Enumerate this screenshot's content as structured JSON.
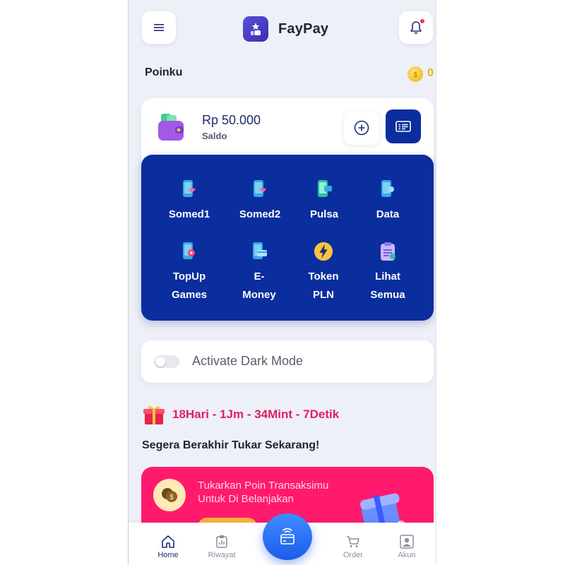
{
  "header": {
    "app_name": "FayPay"
  },
  "points": {
    "title": "Poinku",
    "value": "0"
  },
  "balance": {
    "amount": "Rp 50.000",
    "label": "Saldo"
  },
  "services": [
    {
      "label": "Somed1",
      "icon": "phone-heart-icon"
    },
    {
      "label": "Somed2",
      "icon": "phone-heart-icon"
    },
    {
      "label": "Pulsa",
      "icon": "phone-transfer-icon"
    },
    {
      "label": "Data",
      "icon": "phone-data-icon"
    },
    {
      "label_lines": [
        "TopUp",
        "Games"
      ],
      "icon": "phone-play-icon"
    },
    {
      "label_lines": [
        "E-",
        "Money"
      ],
      "icon": "emoney-card-icon"
    },
    {
      "label_lines": [
        "Token",
        "PLN"
      ],
      "icon": "lightning-icon"
    },
    {
      "label_lines": [
        "Lihat",
        "Semua"
      ],
      "icon": "clipboard-icon"
    }
  ],
  "dark_mode": {
    "label": "Activate Dark Mode",
    "enabled": false
  },
  "countdown": {
    "text": "18Hari - 1Jm - 34Mint - 7Detik"
  },
  "promo": {
    "heading": "Segera Berakhir Tukar Sekarang!",
    "text": "Tukarkan Poin Transaksimu Untuk Di Belanjakan"
  },
  "bottom_nav": [
    {
      "label": "Home",
      "icon": "home-icon",
      "active": true
    },
    {
      "label": "Riwayat",
      "icon": "history-icon",
      "active": false
    },
    {
      "label": "Order",
      "icon": "cart-icon",
      "active": false
    },
    {
      "label": "Akun",
      "icon": "account-icon",
      "active": false
    }
  ],
  "colors": {
    "primary": "#0a2e9e",
    "accent_pink": "#ff1a6e",
    "countdown": "#e01e63",
    "coin": "#f1b400",
    "fab": "#1c5dea"
  }
}
